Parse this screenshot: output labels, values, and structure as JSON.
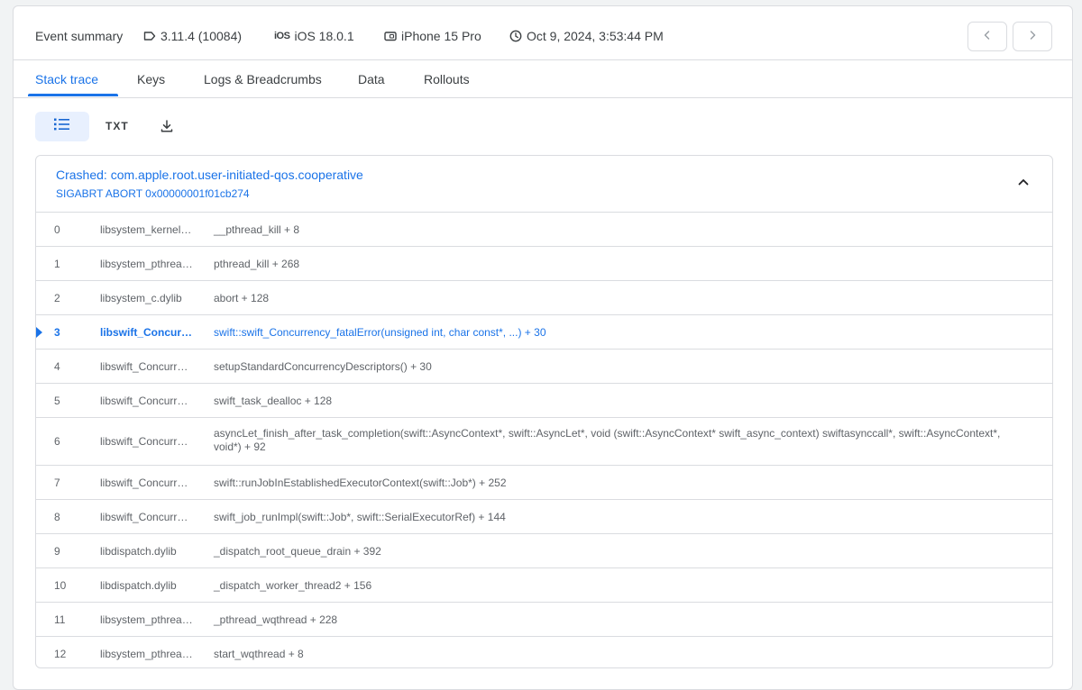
{
  "summary": {
    "title": "Event summary",
    "version": "3.11.4 (10084)",
    "os": "iOS 18.0.1",
    "device": "iPhone 15 Pro",
    "timestamp": "Oct 9, 2024, 3:53:44 PM",
    "os_icon_text": "iOS"
  },
  "tabs": [
    "Stack trace",
    "Keys",
    "Logs & Breadcrumbs",
    "Data",
    "Rollouts"
  ],
  "active_tab": "Stack trace",
  "toolbar": {
    "txt_label": "TXT"
  },
  "crash": {
    "title": "Crashed: com.apple.root.user-initiated-qos.cooperative",
    "subtitle": "SIGABRT ABORT 0x00000001f01cb274"
  },
  "frames": [
    {
      "num": "0",
      "lib": "libsystem_kernel.dylib",
      "fn": "__pthread_kill + 8",
      "highlight": false
    },
    {
      "num": "1",
      "lib": "libsystem_pthread.dylib",
      "fn": "pthread_kill + 268",
      "highlight": false
    },
    {
      "num": "2",
      "lib": "libsystem_c.dylib",
      "fn": "abort + 128",
      "highlight": false
    },
    {
      "num": "3",
      "lib": "libswift_Concurrency.dylib",
      "fn": "swift::swift_Concurrency_fatalError(unsigned int, char const*, ...) + 30",
      "highlight": true
    },
    {
      "num": "4",
      "lib": "libswift_Concurrency.dylib",
      "fn": "setupStandardConcurrencyDescriptors() + 30",
      "highlight": false
    },
    {
      "num": "5",
      "lib": "libswift_Concurrency.dylib",
      "fn": "swift_task_dealloc + 128",
      "highlight": false
    },
    {
      "num": "6",
      "lib": "libswift_Concurrency.dylib",
      "fn": "asyncLet_finish_after_task_completion(swift::AsyncContext*, swift::AsyncLet*, void (swift::AsyncContext* swift_async_context) swiftasynccall*, swift::AsyncContext*, void*) + 92",
      "highlight": false
    },
    {
      "num": "7",
      "lib": "libswift_Concurrency.dylib",
      "fn": "swift::runJobInEstablishedExecutorContext(swift::Job*) + 252",
      "highlight": false
    },
    {
      "num": "8",
      "lib": "libswift_Concurrency.dylib",
      "fn": "swift_job_runImpl(swift::Job*, swift::SerialExecutorRef) + 144",
      "highlight": false
    },
    {
      "num": "9",
      "lib": "libdispatch.dylib",
      "fn": "_dispatch_root_queue_drain + 392",
      "highlight": false
    },
    {
      "num": "10",
      "lib": "libdispatch.dylib",
      "fn": "_dispatch_worker_thread2 + 156",
      "highlight": false
    },
    {
      "num": "11",
      "lib": "libsystem_pthread.dylib",
      "fn": "_pthread_wqthread + 228",
      "highlight": false
    },
    {
      "num": "12",
      "lib": "libsystem_pthread.dylib",
      "fn": "start_wqthread + 8",
      "highlight": false
    }
  ],
  "colors": {
    "accent": "#1a73e8",
    "border": "#dadce0",
    "text": "#3c4043"
  },
  "icons": [
    "tag-icon",
    "ios-icon",
    "device-icon",
    "clock-icon",
    "chevron-left-icon",
    "chevron-right-icon",
    "list-view-icon",
    "download-icon",
    "chevron-up-icon"
  ]
}
